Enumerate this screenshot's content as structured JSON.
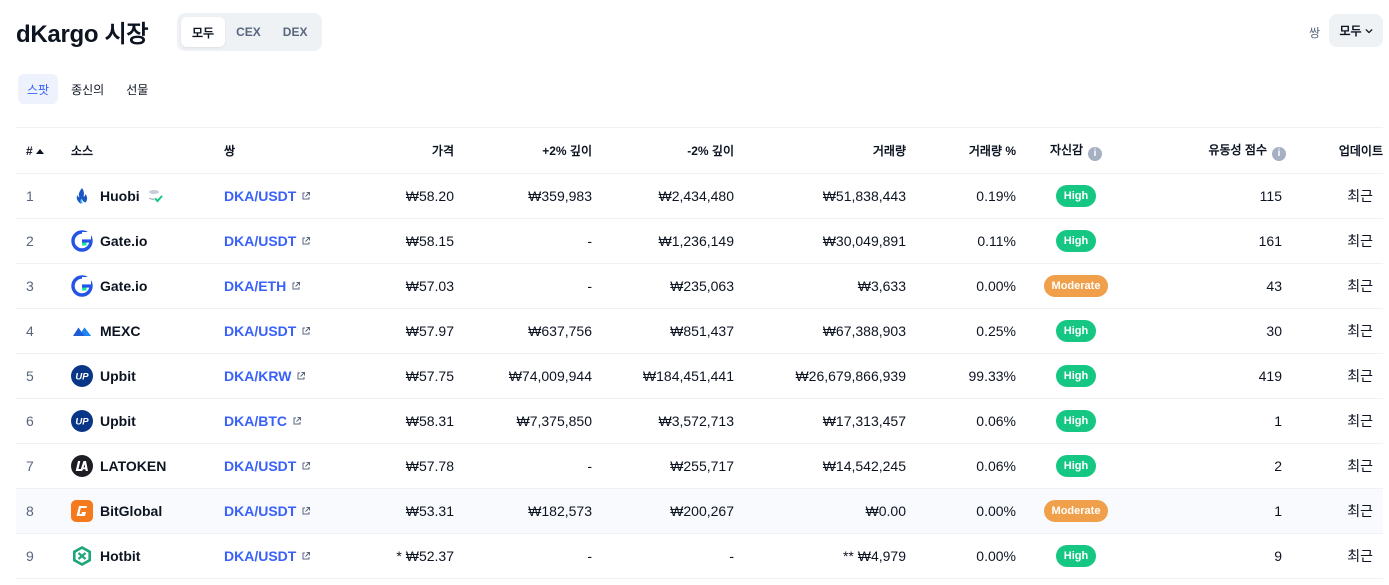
{
  "header": {
    "title": "dKargo 시장",
    "segments": [
      "모두",
      "CEX",
      "DEX"
    ],
    "pair_label": "쌍",
    "pair_value": "모두"
  },
  "subtabs": [
    "스팟",
    "종신의",
    "선물"
  ],
  "columns": {
    "rank": "#",
    "source": "소스",
    "pair": "쌍",
    "price": "가격",
    "depth_plus": "+2% 깊이",
    "depth_minus": "-2% 깊이",
    "volume": "거래량",
    "volume_pct": "거래량 %",
    "confidence": "자신감",
    "liquidity": "유동성 점수",
    "updated": "업데이트"
  },
  "colors": {
    "high": "#16c784",
    "moderate": "#f0a04b",
    "link": "#3861fb"
  },
  "rows": [
    {
      "rank": "1",
      "source": "Huobi",
      "icon": "huobi-flame-icon",
      "pair": "DKA/USDT",
      "price": "₩58.20",
      "depth_plus": "₩359,983",
      "depth_minus": "₩2,434,480",
      "volume": "₩51,838,443",
      "volume_pct": "0.19%",
      "confidence": "High",
      "liquidity": "115",
      "updated": "최근"
    },
    {
      "rank": "2",
      "source": "Gate.io",
      "icon": "gateio-icon",
      "pair": "DKA/USDT",
      "price": "₩58.15",
      "depth_plus": "-",
      "depth_minus": "₩1,236,149",
      "volume": "₩30,049,891",
      "volume_pct": "0.11%",
      "confidence": "High",
      "liquidity": "161",
      "updated": "최근"
    },
    {
      "rank": "3",
      "source": "Gate.io",
      "icon": "gateio-icon",
      "pair": "DKA/ETH",
      "price": "₩57.03",
      "depth_plus": "-",
      "depth_minus": "₩235,063",
      "volume": "₩3,633",
      "volume_pct": "0.00%",
      "confidence": "Moderate",
      "liquidity": "43",
      "updated": "최근"
    },
    {
      "rank": "4",
      "source": "MEXC",
      "icon": "mexc-icon",
      "pair": "DKA/USDT",
      "price": "₩57.97",
      "depth_plus": "₩637,756",
      "depth_minus": "₩851,437",
      "volume": "₩67,388,903",
      "volume_pct": "0.25%",
      "confidence": "High",
      "liquidity": "30",
      "updated": "최근"
    },
    {
      "rank": "5",
      "source": "Upbit",
      "icon": "upbit-icon",
      "pair": "DKA/KRW",
      "price": "₩57.75",
      "depth_plus": "₩74,009,944",
      "depth_minus": "₩184,451,441",
      "volume": "₩26,679,866,939",
      "volume_pct": "99.33%",
      "confidence": "High",
      "liquidity": "419",
      "updated": "최근"
    },
    {
      "rank": "6",
      "source": "Upbit",
      "icon": "upbit-icon",
      "pair": "DKA/BTC",
      "price": "₩58.31",
      "depth_plus": "₩7,375,850",
      "depth_minus": "₩3,572,713",
      "volume": "₩17,313,457",
      "volume_pct": "0.06%",
      "confidence": "High",
      "liquidity": "1",
      "updated": "최근"
    },
    {
      "rank": "7",
      "source": "LATOKEN",
      "icon": "latoken-icon",
      "pair": "DKA/USDT",
      "price": "₩57.78",
      "depth_plus": "-",
      "depth_minus": "₩255,717",
      "volume": "₩14,542,245",
      "volume_pct": "0.06%",
      "confidence": "High",
      "liquidity": "2",
      "updated": "최근"
    },
    {
      "rank": "8",
      "source": "BitGlobal",
      "icon": "bitglobal-icon",
      "pair": "DKA/USDT",
      "price": "₩53.31",
      "depth_plus": "₩182,573",
      "depth_minus": "₩200,267",
      "volume": "₩0.00",
      "volume_pct": "0.00%",
      "confidence": "Moderate",
      "liquidity": "1",
      "updated": "최근"
    },
    {
      "rank": "9",
      "source": "Hotbit",
      "icon": "hotbit-icon",
      "pair": "DKA/USDT",
      "price": "* ₩52.37",
      "depth_plus": "-",
      "depth_minus": "-",
      "volume": "** ₩4,979",
      "volume_pct": "0.00%",
      "confidence": "High",
      "liquidity": "9",
      "updated": "최근"
    }
  ]
}
